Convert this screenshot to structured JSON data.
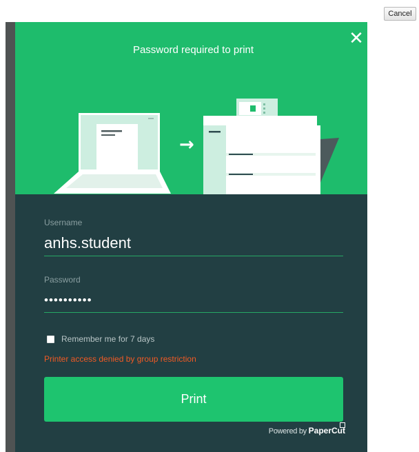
{
  "toolbar": {
    "cancel_label": "Cancel"
  },
  "dialog": {
    "title": "Password required to print",
    "close_icon": "close-icon",
    "illustration": {
      "arrow_glyph": "→"
    }
  },
  "form": {
    "username": {
      "label": "Username",
      "value": "anhs.student"
    },
    "password": {
      "label": "Password",
      "value": "••••••••••"
    },
    "remember": {
      "label": "Remember me for 7 days",
      "checked": false
    },
    "error_text": "Printer access denied by group restriction",
    "print_label": "Print"
  },
  "footer": {
    "powered_prefix": "Powered by ",
    "brand": "PaperCut"
  },
  "colors": {
    "hero_green": "#1ebc6c",
    "panel_dark": "#223f43",
    "button_green": "#1ec46f",
    "error_orange": "#f15a24"
  }
}
